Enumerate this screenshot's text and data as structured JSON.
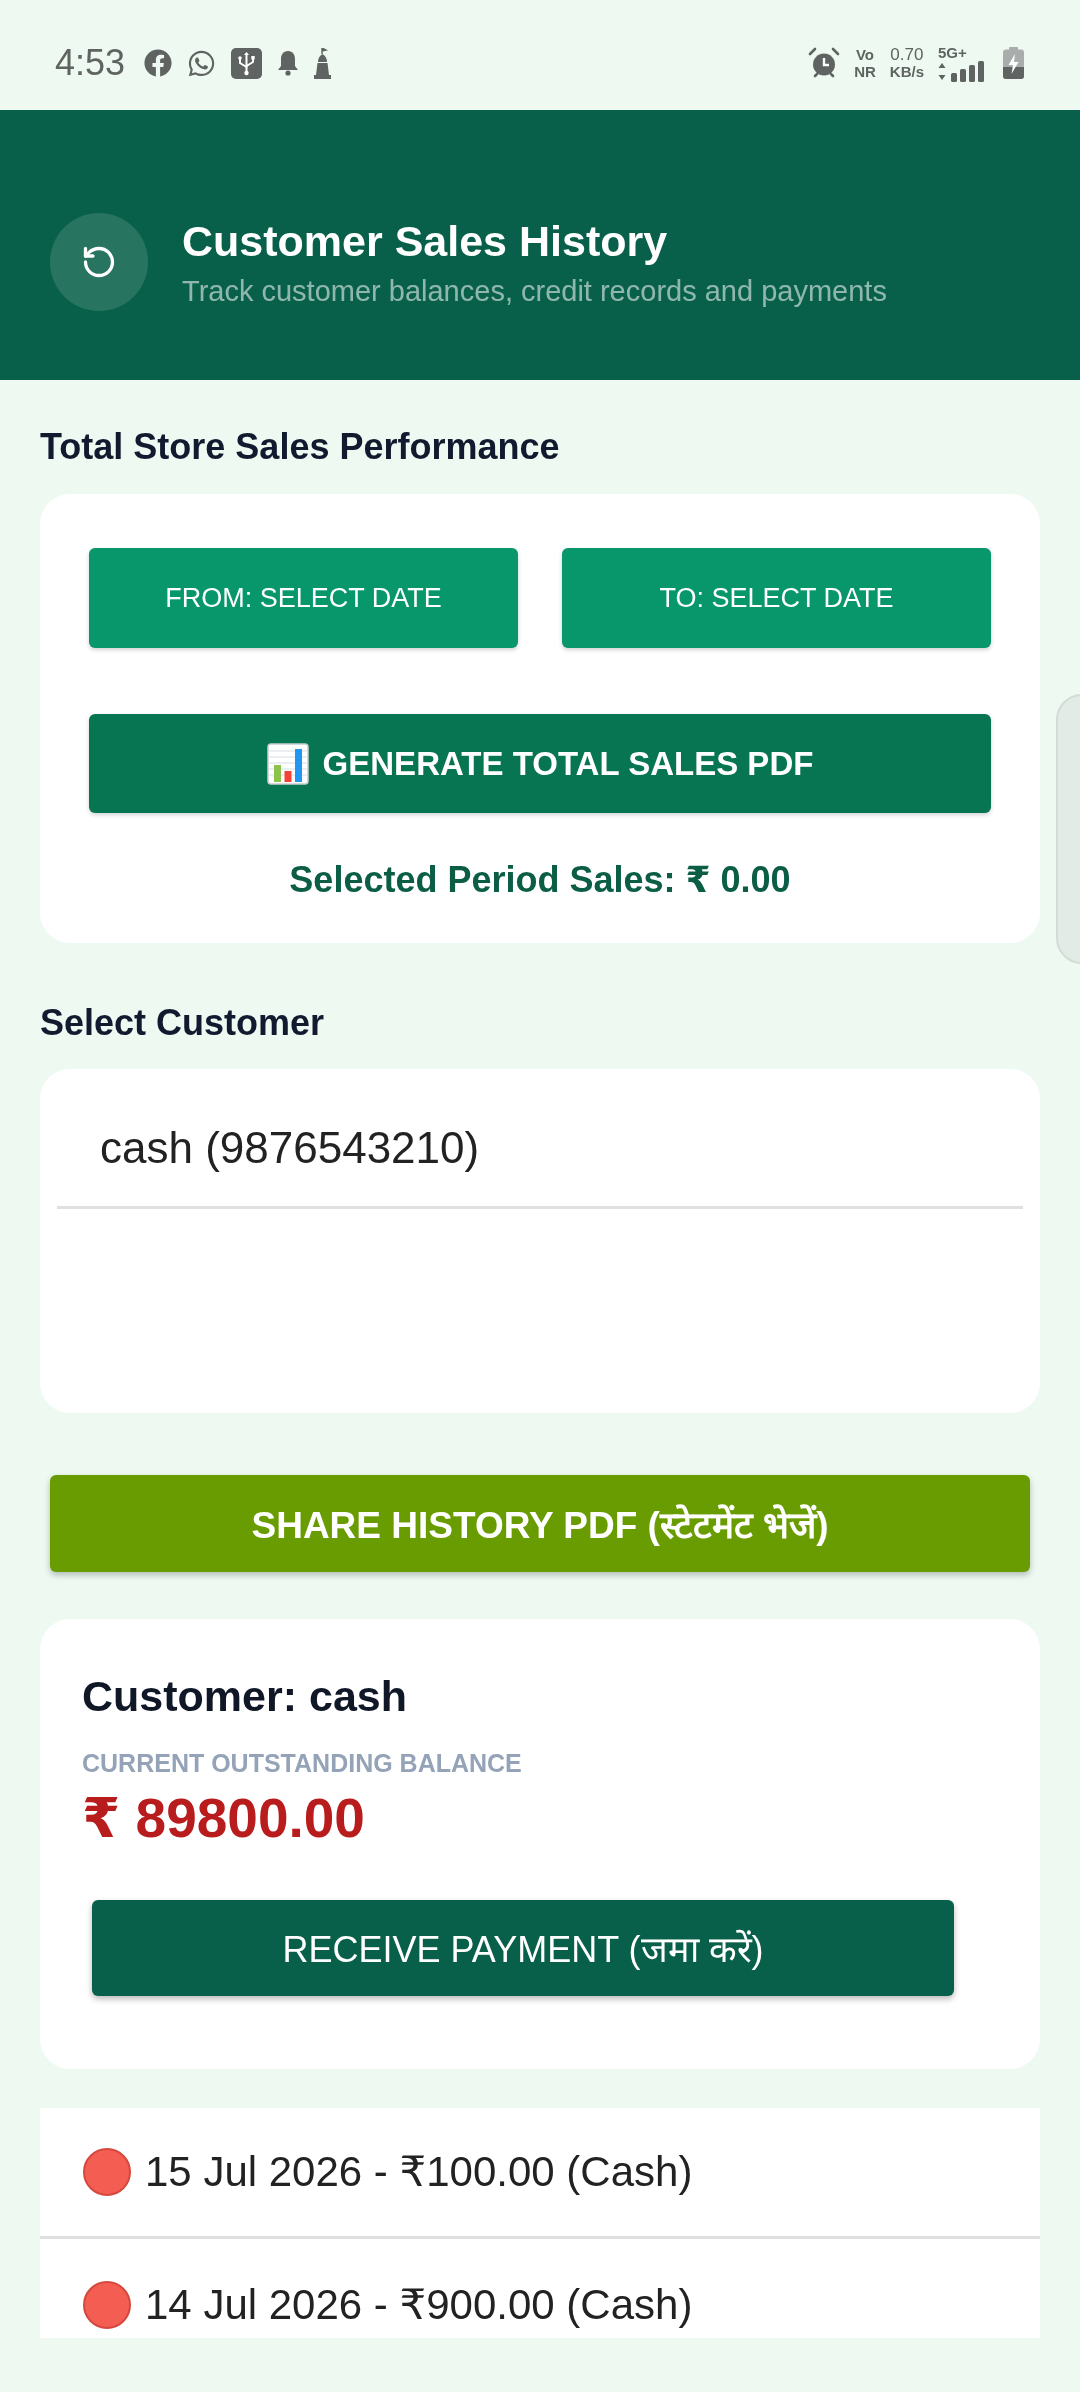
{
  "status_bar": {
    "time": "4:53",
    "volte": [
      "Vo",
      "NR"
    ],
    "speed": {
      "value": "0.70",
      "unit": "KB/s"
    },
    "network": "5G+"
  },
  "header": {
    "title": "Customer Sales History",
    "subtitle": "Track customer balances, credit records and payments"
  },
  "sales_section": {
    "heading": "Total Store Sales Performance",
    "from_button": "FROM: SELECT DATE",
    "to_button": "TO: SELECT DATE",
    "generate_button": "GENERATE TOTAL SALES PDF",
    "period_sales": "Selected Period Sales: ₹ 0.00"
  },
  "customer_section": {
    "heading": "Select Customer",
    "picker": {
      "value": "cash (9876543210)"
    }
  },
  "share_button": "SHARE HISTORY PDF (स्टेटमेंट भेजें)",
  "customer_card": {
    "name": "Customer: cash",
    "balance_label": "CURRENT OUTSTANDING BALANCE",
    "balance": "₹ 89800.00",
    "receive_button": "RECEIVE PAYMENT (जमा करें)"
  },
  "transactions": [
    {
      "text": "15 Jul 2026 - ₹100.00 (Cash)",
      "color": "#f45d52"
    },
    {
      "text": "14 Jul 2026 - ₹900.00 (Cash)",
      "color": "#f45d52"
    }
  ]
}
